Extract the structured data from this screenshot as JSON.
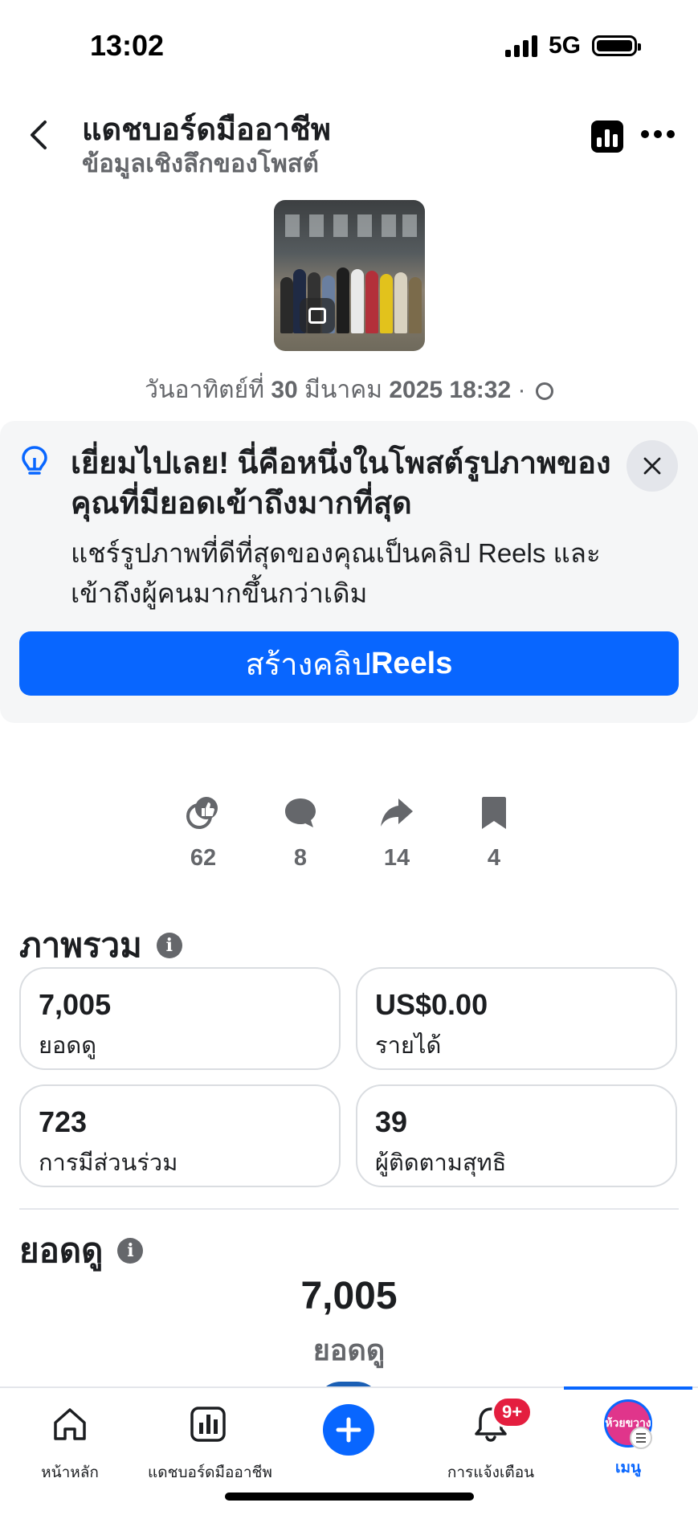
{
  "status_bar": {
    "time": "13:02",
    "network": "5G"
  },
  "header": {
    "title": "แดชบอร์ดมืออาชีพ",
    "subtitle": "ข้อมูลเชิงลึกของโพสต์"
  },
  "post": {
    "date_prefix": "วันอาทิตย์ที่ ",
    "date_day": "30",
    "date_month": " มีนาคม ",
    "date_rest": "2025 18:32",
    "date_sep": " · "
  },
  "tip": {
    "title": "เยี่ยมไปเลย! นี่คือหนึ่งในโพสต์รูปภาพของคุณที่มียอดเข้าถึงมากที่สุด",
    "body": "แชร์รูปภาพที่ดีที่สุดของคุณเป็นคลิป Reels และเข้าถึงผู้คนมากขึ้นกว่าเดิม",
    "cta_label_prefix": "สร้างคลิป ",
    "cta_label_bold": "Reels"
  },
  "engagement": {
    "reactions": "62",
    "comments": "8",
    "shares": "14",
    "saves": "4"
  },
  "overview": {
    "title": "ภาพรวม",
    "cards": [
      {
        "value": "7,005",
        "label": "ยอดดู"
      },
      {
        "value": "US$0.00",
        "label": "รายได้"
      },
      {
        "value": "723",
        "label": "การมีส่วนร่วม"
      },
      {
        "value": "39",
        "label": "ผู้ติดตามสุทธิ"
      }
    ]
  },
  "views": {
    "title": "ยอดดู",
    "total": "7,005",
    "total_label": "ยอดดู"
  },
  "bottom_nav": {
    "home": "หน้าหลัก",
    "dashboard": "แดชบอร์ดมืออาชีพ",
    "notifications": "การแจ้งเตือน",
    "notifications_badge": "9+",
    "menu": "เมนู",
    "avatar_text": "ห้วยขวาง"
  },
  "colors": {
    "accent": "#0866ff",
    "badge": "#e41e3f",
    "muted": "#65676b"
  }
}
